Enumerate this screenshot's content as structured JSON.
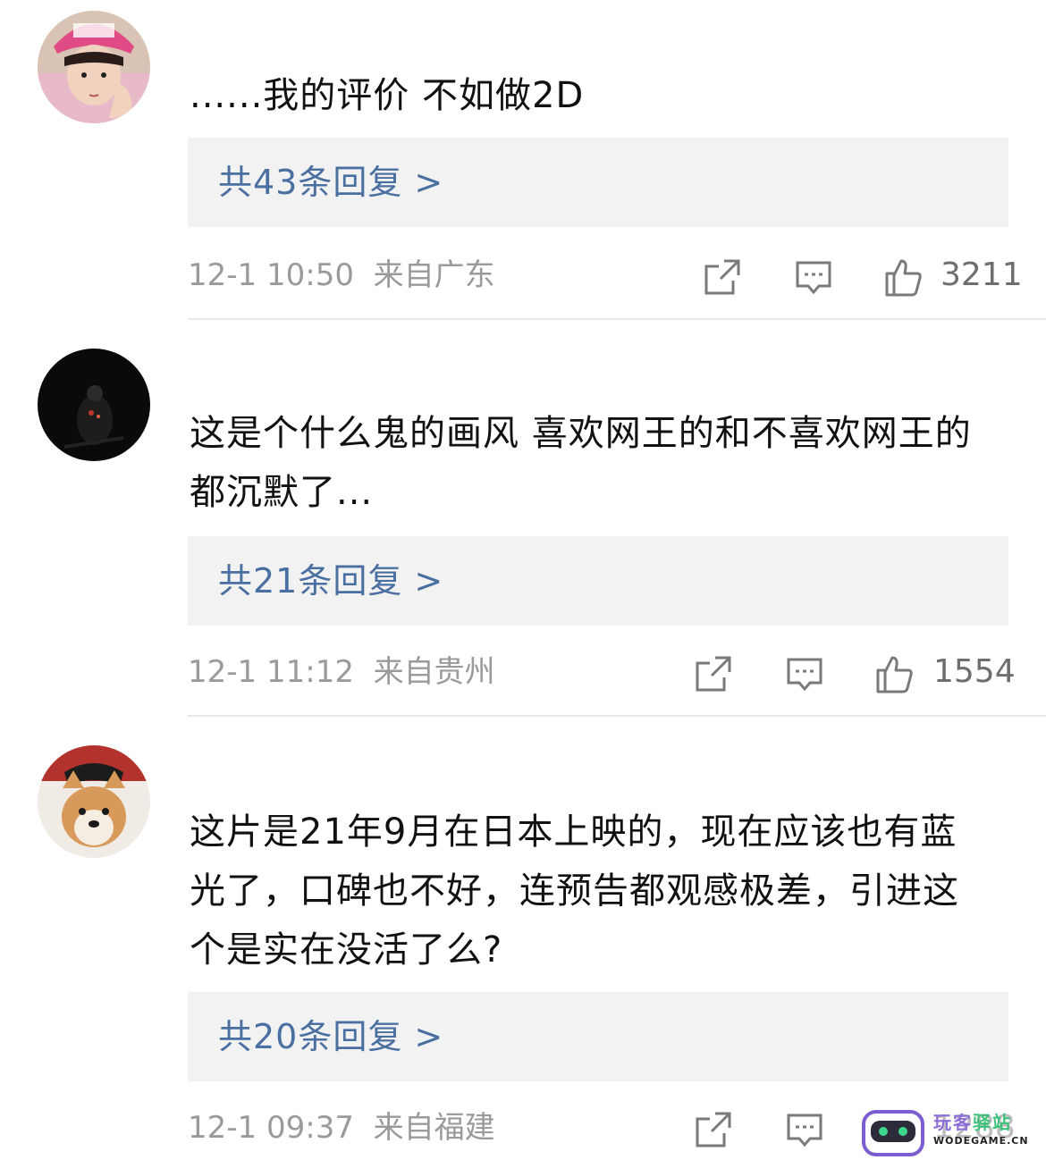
{
  "comments": [
    {
      "avatar_icon": "girl-pink-cap-avatar",
      "text": "......我的评价 不如做2D",
      "replies_label": "共43条回复 >",
      "time": "12-1 10:50",
      "location": "来自广东",
      "likes": "3211"
    },
    {
      "avatar_icon": "dark-figure-avatar",
      "text": "这是个什么鬼的画风 喜欢网王的和不喜欢网王的都沉默了...",
      "replies_label": "共21条回复 >",
      "time": "12-1 11:12",
      "location": "来自贵州",
      "likes": "1554"
    },
    {
      "avatar_icon": "shiba-dog-avatar",
      "text": "这片是21年9月在日本上映的，现在应该也有蓝光了，口碑也不好，连预告都观感极差，引进这个是实在没活了么?",
      "replies_label": "共20条回复 >",
      "time": "12-1 09:37",
      "location": "来自福建",
      "likes": "1288"
    }
  ],
  "icons": {
    "share": "share-icon",
    "comment": "comment-icon",
    "like": "thumbs-up-icon"
  },
  "colors": {
    "link": "#4a6fa1",
    "meta": "#9a9a9a",
    "reply_bg": "#f2f2f2"
  },
  "watermark": {
    "title_a": "玩客",
    "title_b": "驿站",
    "subtitle": "WODEGAME.CN"
  }
}
